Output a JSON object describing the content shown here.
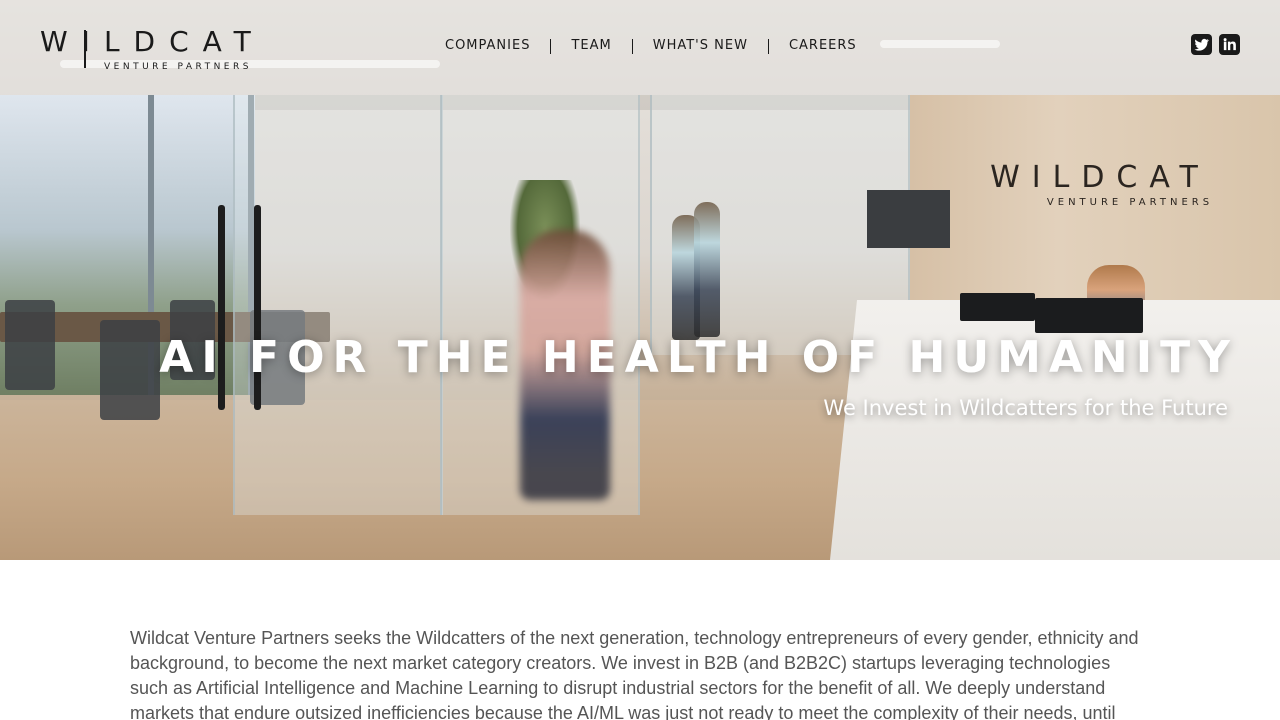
{
  "brand": {
    "logo_main": "WILDCAT",
    "logo_sub": "VENTURE PARTNERS"
  },
  "nav": {
    "items": [
      {
        "label": "COMPANIES"
      },
      {
        "label": "TEAM"
      },
      {
        "label": "WHAT'S NEW"
      },
      {
        "label": "CAREERS"
      }
    ]
  },
  "social": {
    "items": [
      {
        "icon": "twitter-icon"
      },
      {
        "icon": "linkedin-icon"
      }
    ]
  },
  "hero": {
    "title": "AI FOR THE HEALTH OF HUMANITY",
    "subtitle": "We Invest in Wildcatters for the Future",
    "wall_logo_main": "WILDCAT",
    "wall_logo_sub": "VENTURE PARTNERS"
  },
  "intro": {
    "text": "Wildcat Venture Partners seeks the Wildcatters of the next generation, technology entrepreneurs of every gender, ethnicity and background, to become the next market category creators. We invest in B2B (and B2B2C) startups leveraging technologies such as Artificial Intelligence and Machine Learning to disrupt industrial sectors for the benefit of all. We deeply understand markets that endure outsized inefficiencies because the AI/ML was just not ready to meet the complexity of their needs, until now. With a forward"
  },
  "colors": {
    "header_text": "#1a1a1a",
    "hero_text": "#ffffff",
    "body_text": "#555555"
  }
}
